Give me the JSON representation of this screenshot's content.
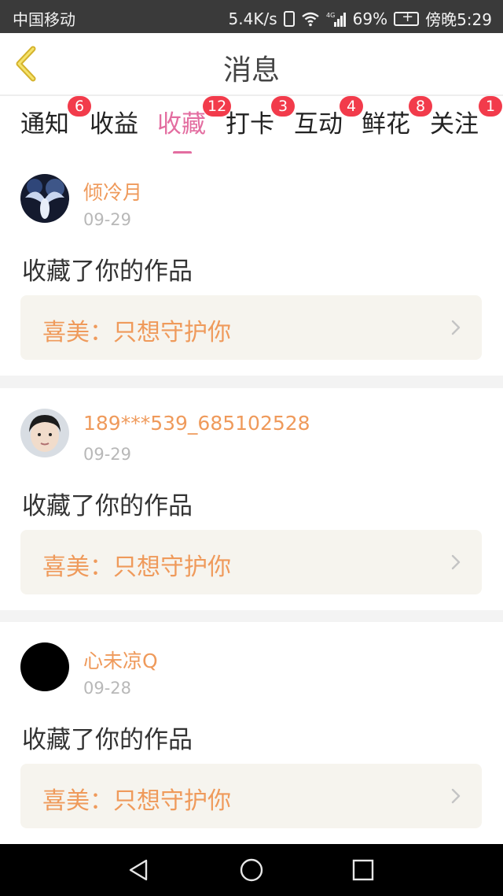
{
  "status_bar": {
    "carrier": "中国移动",
    "speed": "5.4K/s",
    "network": "4G",
    "battery": "69%",
    "time": "傍晚5:29"
  },
  "header": {
    "title": "消息",
    "back_icon": "back-chevron-icon"
  },
  "tabs": [
    {
      "label": "通知",
      "badge": "6"
    },
    {
      "label": "收益",
      "badge": ""
    },
    {
      "label": "收藏",
      "badge": "12",
      "active": true
    },
    {
      "label": "打卡",
      "badge": "3"
    },
    {
      "label": "互动",
      "badge": "4"
    },
    {
      "label": "鲜花",
      "badge": "8"
    },
    {
      "label": "关注",
      "badge": "1"
    }
  ],
  "messages": [
    {
      "username": "倾冷月",
      "date": "09-29",
      "action": "收藏了你的作品",
      "work": "喜美：只想守护你"
    },
    {
      "username": "189***539_685102528",
      "date": "09-29",
      "action": "收藏了你的作品",
      "work": "喜美：只想守护你"
    },
    {
      "username": "心未凉Q",
      "date": "09-28",
      "action": "收藏了你的作品",
      "work": "喜美：只想守护你"
    }
  ],
  "colors": {
    "accent": "#e36da0",
    "username": "#ef9a5b",
    "badge": "#f23b4b",
    "card_bg": "#f6f4ee"
  }
}
